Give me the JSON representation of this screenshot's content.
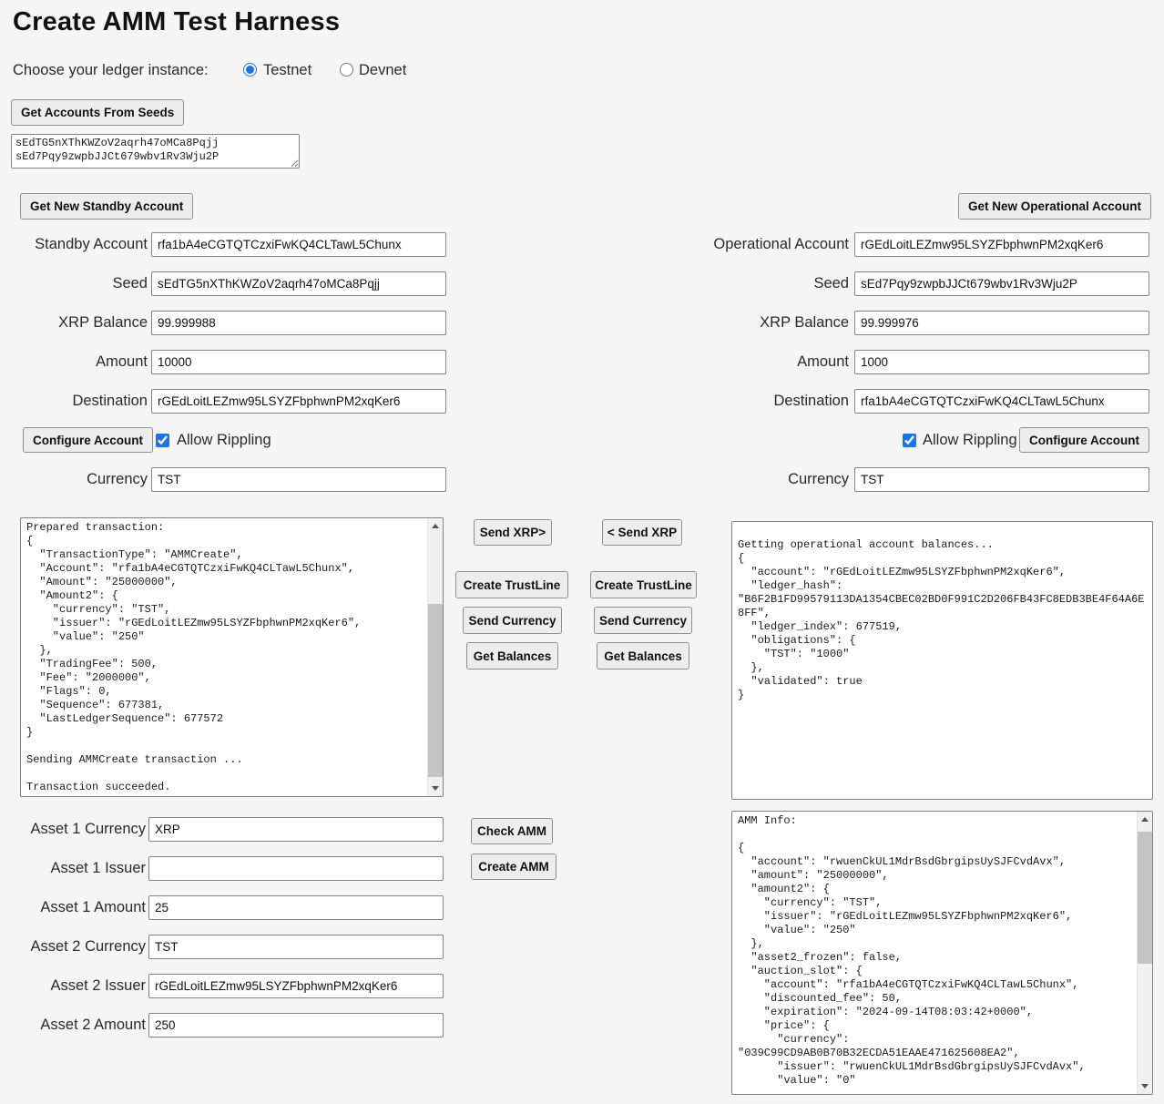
{
  "colors": {
    "accent_blue": "#1a73e8",
    "page_bg": "#f5f5f6"
  },
  "title": "Create AMM Test Harness",
  "ledger_chooser": {
    "label": "Choose your ledger instance:",
    "options": [
      {
        "label": "Testnet",
        "checked": true
      },
      {
        "label": "Devnet",
        "checked": false
      }
    ]
  },
  "seeds": {
    "get_accounts_button": "Get Accounts From Seeds",
    "textarea_value": "sEdTG5nXThKWZoV2aqrh47oMCa8Pqjj\nsEd7Pqy9zwpbJJCt679wbv1Rv3Wju2P"
  },
  "standby": {
    "get_new_account_button": "Get New Standby Account",
    "fields": {
      "account": {
        "label": "Standby Account",
        "value": "rfa1bA4eCGTQTCzxiFwKQ4CLTawL5Chunx"
      },
      "seed": {
        "label": "Seed",
        "value": "sEdTG5nXThKWZoV2aqrh47oMCa8Pqjj"
      },
      "xrp_balance": {
        "label": "XRP Balance",
        "value": "99.999988"
      },
      "amount": {
        "label": "Amount",
        "value": "10000"
      },
      "destination": {
        "label": "Destination",
        "value": "rGEdLoitLEZmw95LSYZFbphwnPM2xqKer6"
      },
      "currency": {
        "label": "Currency",
        "value": "TST"
      }
    },
    "configure_account_button": "Configure Account",
    "allow_rippling": {
      "label": "Allow Rippling",
      "checked": true
    },
    "actions": {
      "send_xrp": "Send XRP>",
      "create_trustline": "Create TrustLine",
      "send_currency": "Send Currency",
      "get_balances": "Get Balances"
    },
    "results": "Prepared transaction:\n{\n  \"TransactionType\": \"AMMCreate\",\n  \"Account\": \"rfa1bA4eCGTQTCzxiFwKQ4CLTawL5Chunx\",\n  \"Amount\": \"25000000\",\n  \"Amount2\": {\n    \"currency\": \"TST\",\n    \"issuer\": \"rGEdLoitLEZmw95LSYZFbphwnPM2xqKer6\",\n    \"value\": \"250\"\n  },\n  \"TradingFee\": 500,\n  \"Fee\": \"2000000\",\n  \"Flags\": 0,\n  \"Sequence\": 677381,\n  \"LastLedgerSequence\": 677572\n}\n\nSending AMMCreate transaction ...\n\nTransaction succeeded."
  },
  "operational": {
    "get_new_account_button": "Get New Operational Account",
    "fields": {
      "account": {
        "label": "Operational Account",
        "value": "rGEdLoitLEZmw95LSYZFbphwnPM2xqKer6"
      },
      "seed": {
        "label": "Seed",
        "value": "sEd7Pqy9zwpbJJCt679wbv1Rv3Wju2P"
      },
      "xrp_balance": {
        "label": "XRP Balance",
        "value": "99.999976"
      },
      "amount": {
        "label": "Amount",
        "value": "1000"
      },
      "destination": {
        "label": "Destination",
        "value": "rfa1bA4eCGTQTCzxiFwKQ4CLTawL5Chunx"
      },
      "currency": {
        "label": "Currency",
        "value": "TST"
      }
    },
    "configure_account_button": "Configure Account",
    "allow_rippling": {
      "label": "Allow Rippling",
      "checked": true
    },
    "actions": {
      "send_xrp": "< Send XRP",
      "create_trustline": "Create TrustLine",
      "send_currency": "Send Currency",
      "get_balances": "Get Balances"
    },
    "results": "\nGetting operational account balances...\n{\n  \"account\": \"rGEdLoitLEZmw95LSYZFbphwnPM2xqKer6\",\n  \"ledger_hash\":\n\"B6F2B1FD99579113DA1354CBEC02BD0F991C2D206FB43FC8EDB3BE4F64A6E\n8FF\",\n  \"ledger_index\": 677519,\n  \"obligations\": {\n    \"TST\": \"1000\"\n  },\n  \"validated\": true\n}"
  },
  "amm": {
    "fields": {
      "asset1_currency": {
        "label": "Asset 1 Currency",
        "value": "XRP"
      },
      "asset1_issuer": {
        "label": "Asset 1 Issuer",
        "value": ""
      },
      "asset1_amount": {
        "label": "Asset 1 Amount",
        "value": "25"
      },
      "asset2_currency": {
        "label": "Asset 2 Currency",
        "value": "TST"
      },
      "asset2_issuer": {
        "label": "Asset 2 Issuer",
        "value": "rGEdLoitLEZmw95LSYZFbphwnPM2xqKer6"
      },
      "asset2_amount": {
        "label": "Asset 2 Amount",
        "value": "250"
      }
    },
    "check_amm_button": "Check AMM",
    "create_amm_button": "Create AMM",
    "info": "AMM Info:\n\n{\n  \"account\": \"rwuenCkUL1MdrBsdGbrgipsUySJFCvdAvx\",\n  \"amount\": \"25000000\",\n  \"amount2\": {\n    \"currency\": \"TST\",\n    \"issuer\": \"rGEdLoitLEZmw95LSYZFbphwnPM2xqKer6\",\n    \"value\": \"250\"\n  },\n  \"asset2_frozen\": false,\n  \"auction_slot\": {\n    \"account\": \"rfa1bA4eCGTQTCzxiFwKQ4CLTawL5Chunx\",\n    \"discounted_fee\": 50,\n    \"expiration\": \"2024-09-14T08:03:42+0000\",\n    \"price\": {\n      \"currency\":\n\"039C99CD9AB0B70B32ECDA51EAAE471625608EA2\",\n      \"issuer\": \"rwuenCkUL1MdrBsdGbrgipsUySJFCvdAvx\",\n      \"value\": \"0\""
  }
}
